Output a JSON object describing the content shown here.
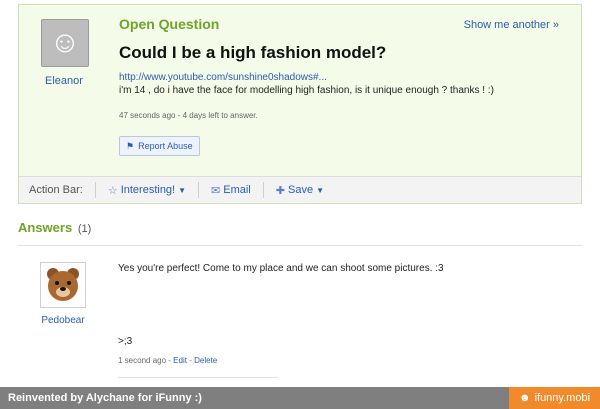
{
  "question": {
    "asker_name": "Eleanor",
    "header": "Open Question",
    "show_another": "Show me another »",
    "title": "Could I be a high fashion model?",
    "link": "http://www.youtube.com/sunshine0shadows#...",
    "body": "i'm 14 , do i have the face for modelling high fashion, is it unique enough ? thanks ! :)",
    "meta": "47 seconds ago - 4 days left to answer.",
    "report_label": "Report Abuse"
  },
  "action_bar": {
    "label": "Action Bar:",
    "interesting": "Interesting!",
    "email": "Email",
    "save": "Save"
  },
  "answers": {
    "heading": "Answers",
    "count": "(1)",
    "items": [
      {
        "name": "Pedobear",
        "text": "Yes you're perfect! Come to my place and we can shoot some pictures. :3",
        "extra": ">;3",
        "time": "1 second ago",
        "edit": "Edit",
        "delete": "Delete"
      }
    ]
  },
  "footer": {
    "credit": "Reinvented by Alychane for iFunny :)",
    "brand": "ifunny.mobi"
  },
  "colors": {
    "accent_green": "#6fa32a",
    "link_blue": "#2a5db0",
    "footer_orange": "#f08a2a"
  }
}
